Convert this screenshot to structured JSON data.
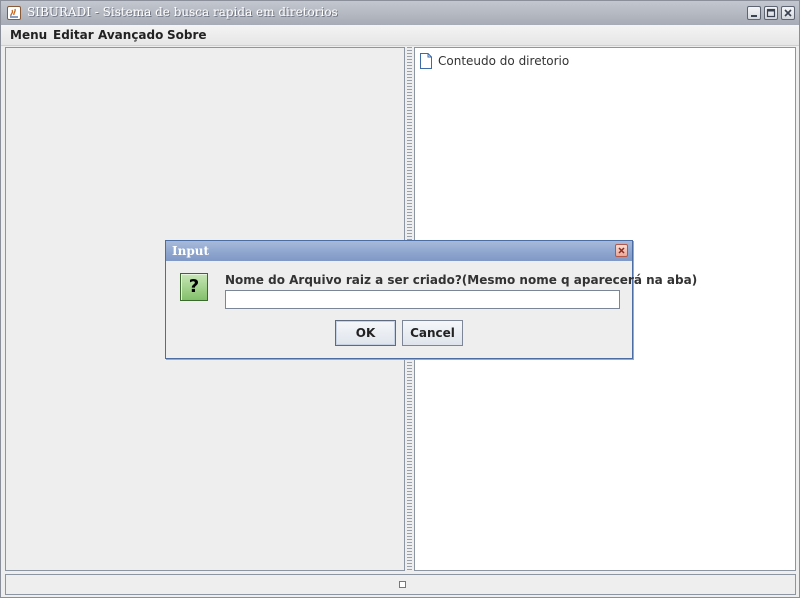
{
  "window": {
    "title": "SIBURADI - Sistema de busca rapida em diretorios"
  },
  "menubar": {
    "items": [
      "Menu",
      "Editar",
      "Avançado",
      "Sobre"
    ]
  },
  "right_pane": {
    "tree_root_label": "Conteudo do diretorio"
  },
  "dialog": {
    "title": "Input",
    "icon": "question-icon",
    "icon_glyph": "?",
    "prompt": "Nome do Arquivo raiz a ser criado?(Mesmo nome q aparecerá na aba)",
    "input_value": "",
    "ok_label": "OK",
    "cancel_label": "Cancel"
  },
  "colors": {
    "window_title_bar": "#b3b8c1",
    "dialog_title_bar": "#8fa6cf",
    "panel_background": "#eeeeee"
  }
}
